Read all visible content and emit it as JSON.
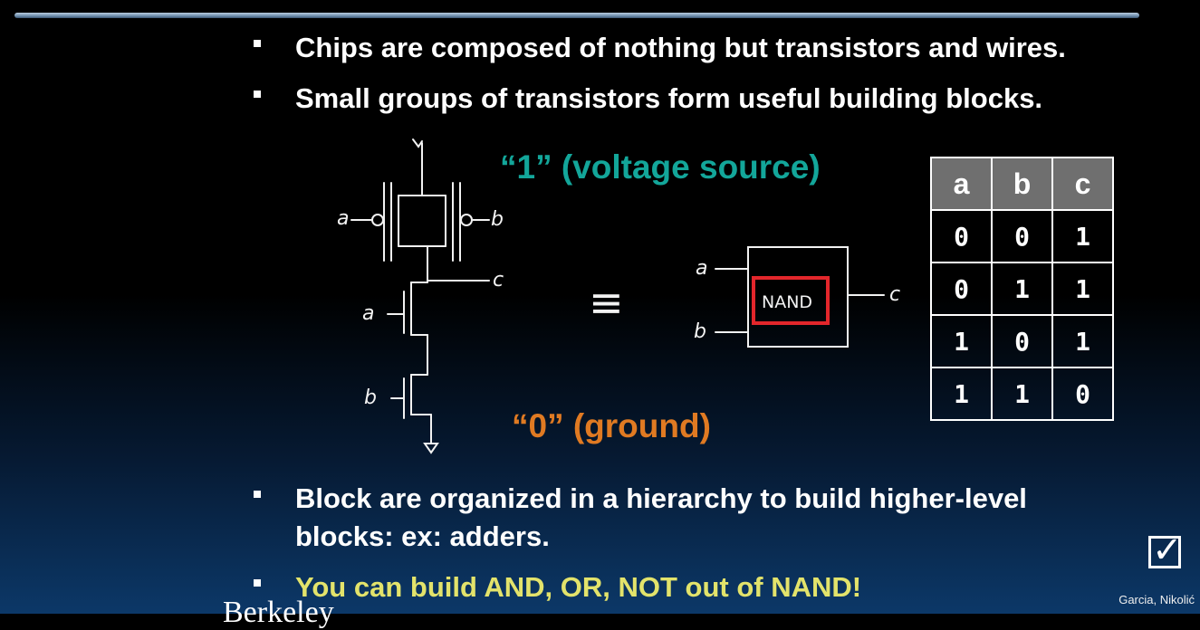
{
  "bullets": {
    "b1": "Chips are composed of nothing but transistors and wires.",
    "b2": "Small groups of transistors form useful building blocks.",
    "b3_line1": "Block are organized in a hierarchy to build higher-level",
    "b3_line2": "blocks: ex: adders.",
    "b4": "You can build AND, OR, NOT out of NAND!"
  },
  "diagram": {
    "source_label": "“1” (voltage source)",
    "ground_label": "“0” (ground)",
    "in_a": "a",
    "in_b": "b",
    "out_c": "c",
    "equiv": "≡",
    "gate": "NAND"
  },
  "truth_table": {
    "headers": [
      "a",
      "b",
      "c"
    ],
    "rows": [
      [
        "0",
        "0",
        "1"
      ],
      [
        "0",
        "1",
        "1"
      ],
      [
        "1",
        "0",
        "1"
      ],
      [
        "1",
        "1",
        "0"
      ]
    ]
  },
  "footer": {
    "credit": "Garcia, Nikolić",
    "check": "✓",
    "cut_text": "Berkeley"
  },
  "colors": {
    "teal": "#13a69a",
    "orange": "#e07a22",
    "yellow": "#e3e36b",
    "nand_box": "#e3262b"
  }
}
